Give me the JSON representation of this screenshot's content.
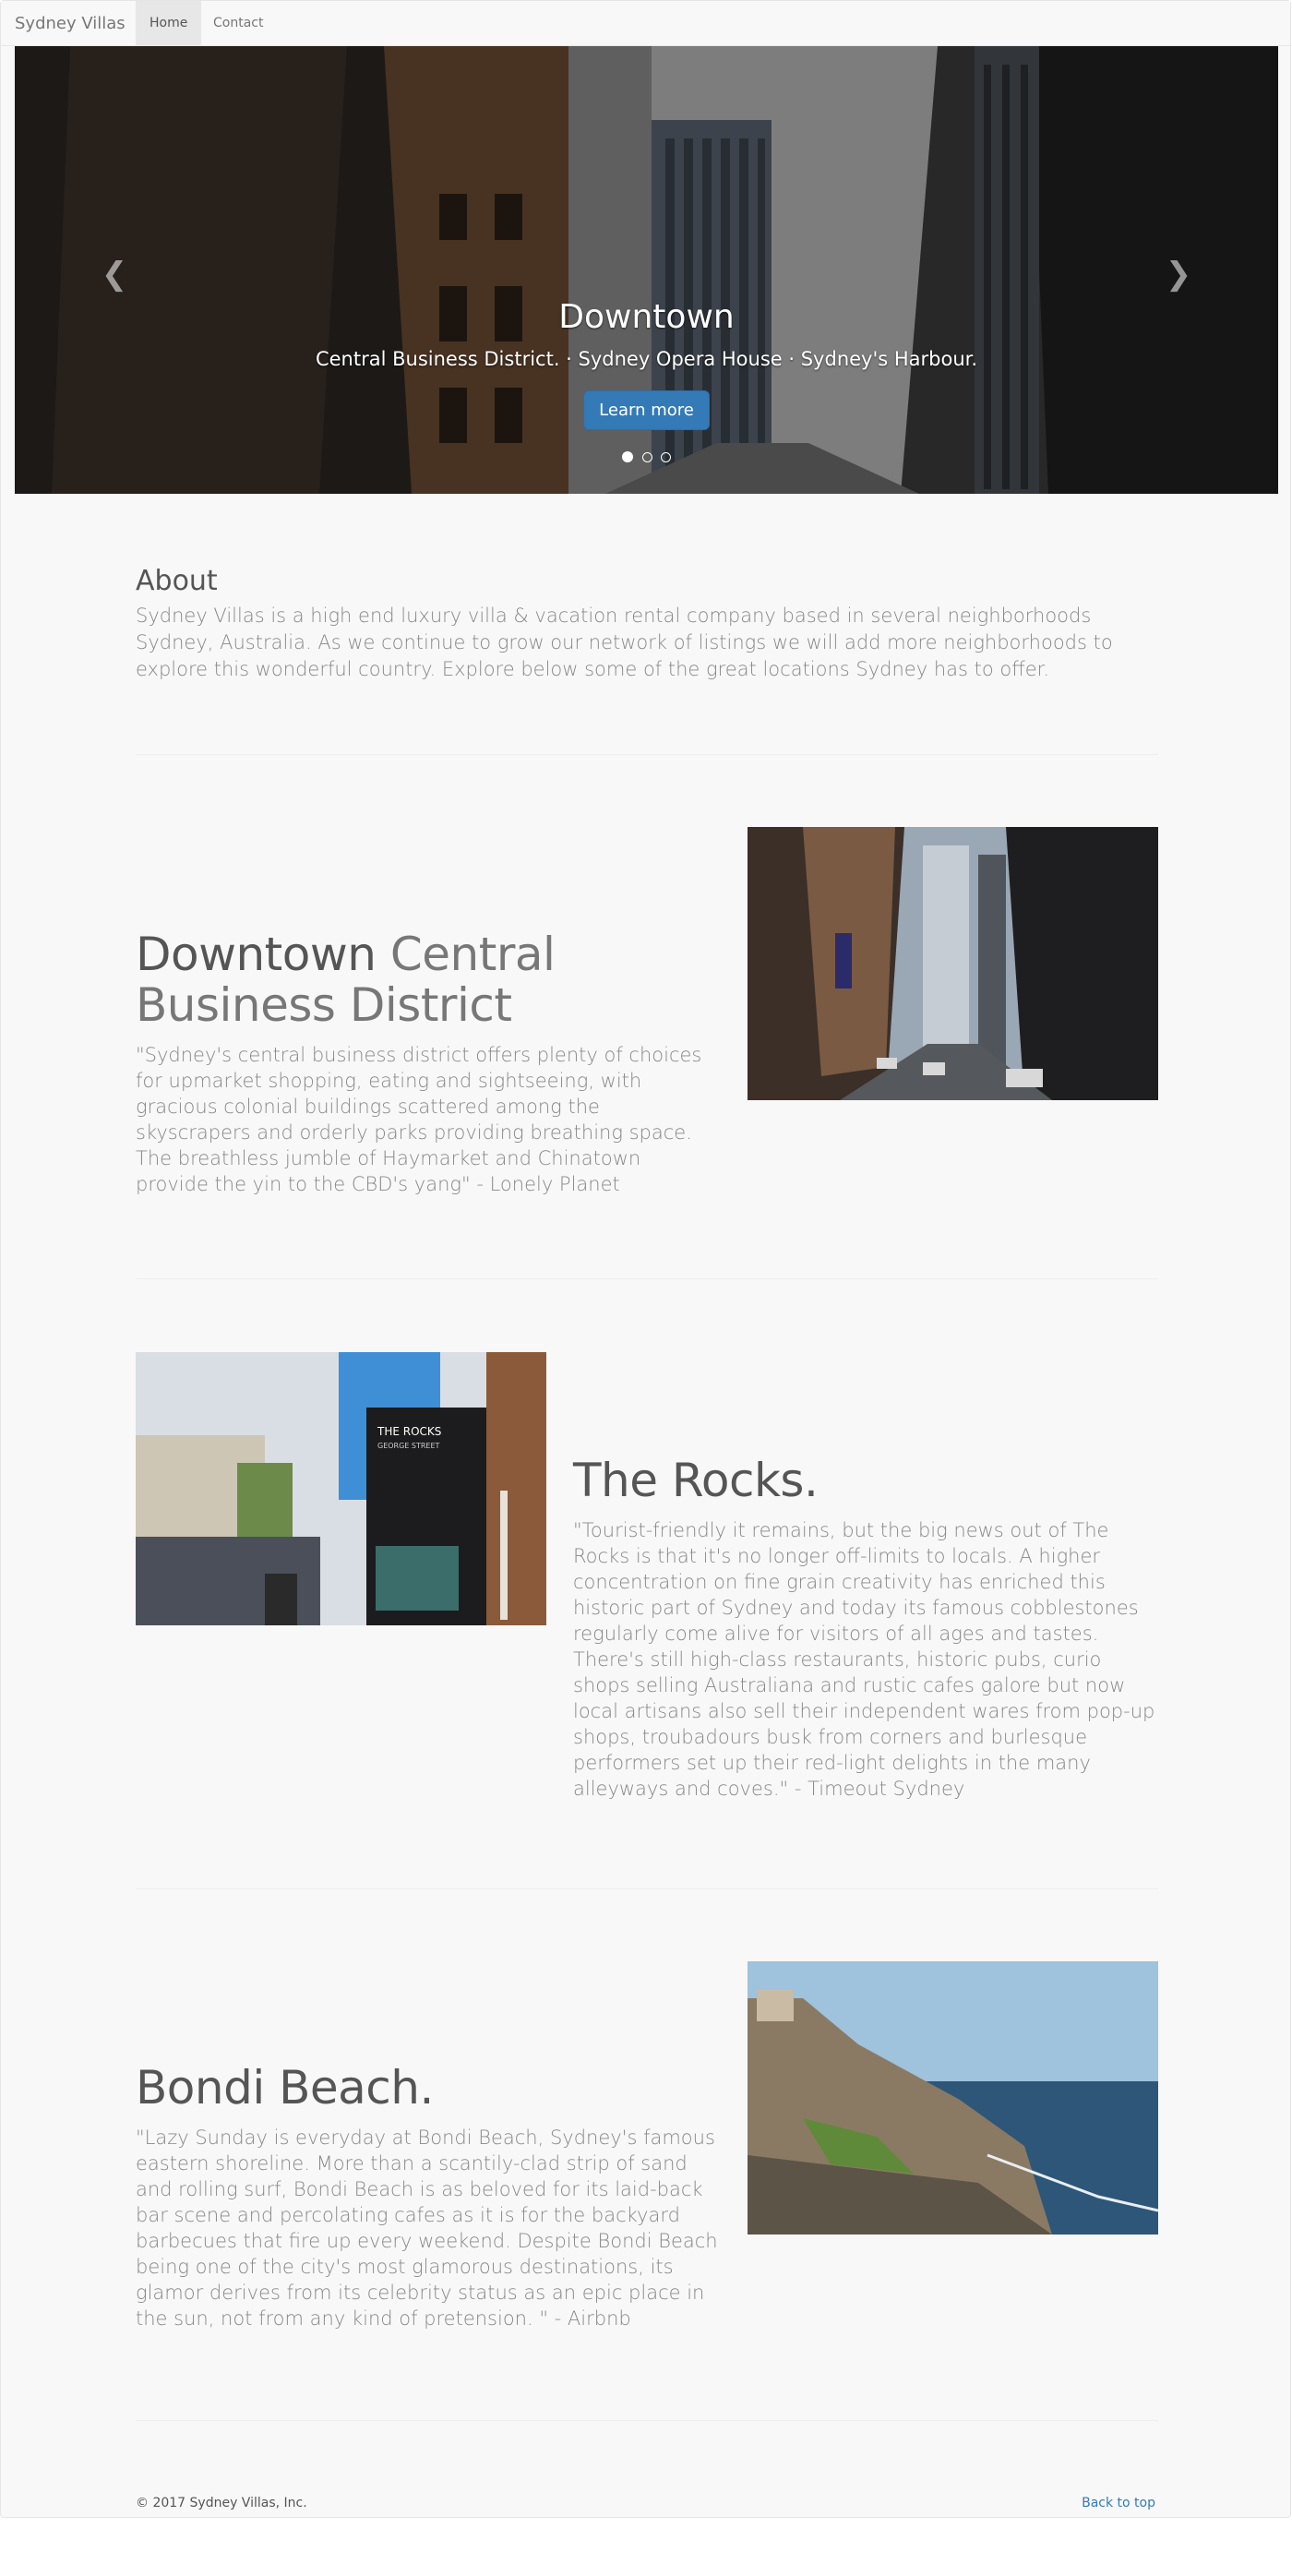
{
  "navbar": {
    "brand": "Sydney Villas",
    "items": [
      {
        "label": "Home",
        "active": true
      },
      {
        "label": "Contact",
        "active": false
      }
    ]
  },
  "hero": {
    "title": "Downtown",
    "subtitle": "Central Business District. · Sydney Opera House · Sydney's Harbour.",
    "button_label": "Learn more",
    "prev_icon": "chevron-left-icon",
    "next_icon": "chevron-right-icon",
    "slide_count": 3,
    "active_slide": 1
  },
  "about": {
    "title": "About",
    "text": "Sydney Villas is a high end luxury villa & vacation rental company based in several neighborhoods Sydney, Australia. As we continue to grow our network of listings we will add more neighborhoods to explore this wonderful country. Explore below some of the great locations Sydney has to offer."
  },
  "features": [
    {
      "heading": "Downtown",
      "heading_muted": "Central Business District",
      "text": "\"Sydney's central business district offers plenty of choices for upmarket shopping, eating and sightseeing, with gracious colonial buildings scattered among the skyscrapers and orderly parks providing breathing space. The breathless jumble of Haymarket and Chinatown provide the yin to the CBD's yang\" - Lonely Planet"
    },
    {
      "heading": "The Rocks.",
      "heading_muted": "",
      "text": "\"Tourist-friendly it remains, but the big news out of The Rocks is that it's no longer off-limits to locals. A higher concentration on fine grain creativity has enriched this historic part of Sydney and today its famous cobblestones regularly come alive for visitors of all ages and tastes. There's still high-class restaurants, historic pubs, curio shops selling Australiana and rustic cafes galore but now local artisans also sell their independent wares from pop-up shops, troubadours busk from corners and burlesque performers set up their red-light delights in the many alleyways and coves.\" - Timeout Sydney",
      "sign_title": "THE ROCKS",
      "sign_subtitle": "GEORGE STREET"
    },
    {
      "heading": "Bondi Beach.",
      "heading_muted": "",
      "text": "\"Lazy Sunday is everyday at Bondi Beach, Sydney's famous eastern shoreline. More than a scantily-clad strip of sand and rolling surf, Bondi Beach is as beloved for its laid-back bar scene and percolating cafes as it is for the backyard barbecues that fire up every weekend. Despite Bondi Beach being one of the city's most glamorous destinations, its glamor derives from its celebrity status as an epic place in the sun, not from any kind of pretension. \" - Airbnb"
    }
  ],
  "footer": {
    "copyright": "© 2017 Sydney Villas, Inc.",
    "back_to_top": "Back to top"
  },
  "colors": {
    "accent": "#337ab7",
    "page_bg": "#f8f8f8"
  }
}
